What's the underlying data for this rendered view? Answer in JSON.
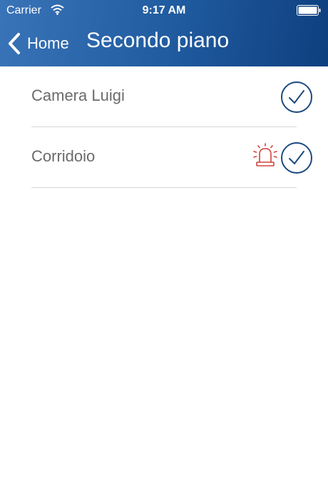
{
  "status_bar": {
    "carrier": "Carrier",
    "time": "9:17 AM",
    "wifi_icon": "wifi-icon",
    "battery_icon": "battery-icon"
  },
  "nav": {
    "back_label": "Home",
    "back_icon": "chevron-left-icon",
    "title": "Secondo piano"
  },
  "colors": {
    "header_start": "#3a74b8",
    "header_end": "#0e3f7f",
    "check": "#1c4a7e",
    "alarm": "#d0423a",
    "row_text": "#6b6b6b",
    "divider": "#d6d6d6"
  },
  "rooms": [
    {
      "name": "Camera Luigi",
      "alarm": false,
      "status_icon": "check-circle-icon"
    },
    {
      "name": "Corridoio",
      "alarm": true,
      "alarm_icon": "siren-icon",
      "status_icon": "check-circle-icon"
    }
  ]
}
